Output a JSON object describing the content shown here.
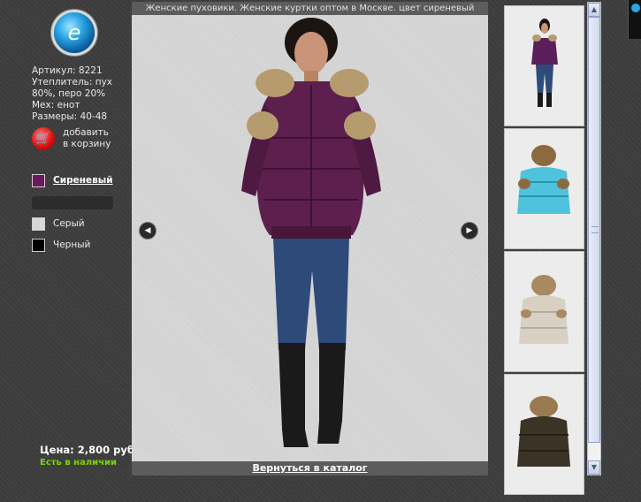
{
  "product": {
    "specs": [
      "Артикул: 8221",
      "Утеплитель: пух",
      "80%, перо 20%",
      "Мех: енот",
      "Размеры: 40-48"
    ],
    "add_to_cart_label": [
      "добавить",
      "в корзину"
    ],
    "price": "Цена: 2,800 руб.",
    "availability": "Есть в наличии"
  },
  "colors": [
    {
      "label": "Сиреневый",
      "hex": "#6a1a5c",
      "selected": true
    },
    {
      "label": "Серый",
      "hex": "#d8d8d8",
      "selected": false
    },
    {
      "label": "Черный",
      "hex": "#000000",
      "selected": false
    }
  ],
  "viewer": {
    "title": "Женские пуховики. Женские куртки оптом в Москве. цвет сиреневый",
    "back_link": "Вернуться в каталог",
    "prev_icon": "chevron-left-icon",
    "next_icon": "chevron-right-icon"
  },
  "thumbnails": [
    {
      "alt": "purple jacket full length",
      "color": "#5a1f5a"
    },
    {
      "alt": "turquoise jacket",
      "color": "#4fc3dd"
    },
    {
      "alt": "beige jacket",
      "color": "#d8d0c2"
    },
    {
      "alt": "dark brown jacket",
      "color": "#3a3326"
    }
  ]
}
